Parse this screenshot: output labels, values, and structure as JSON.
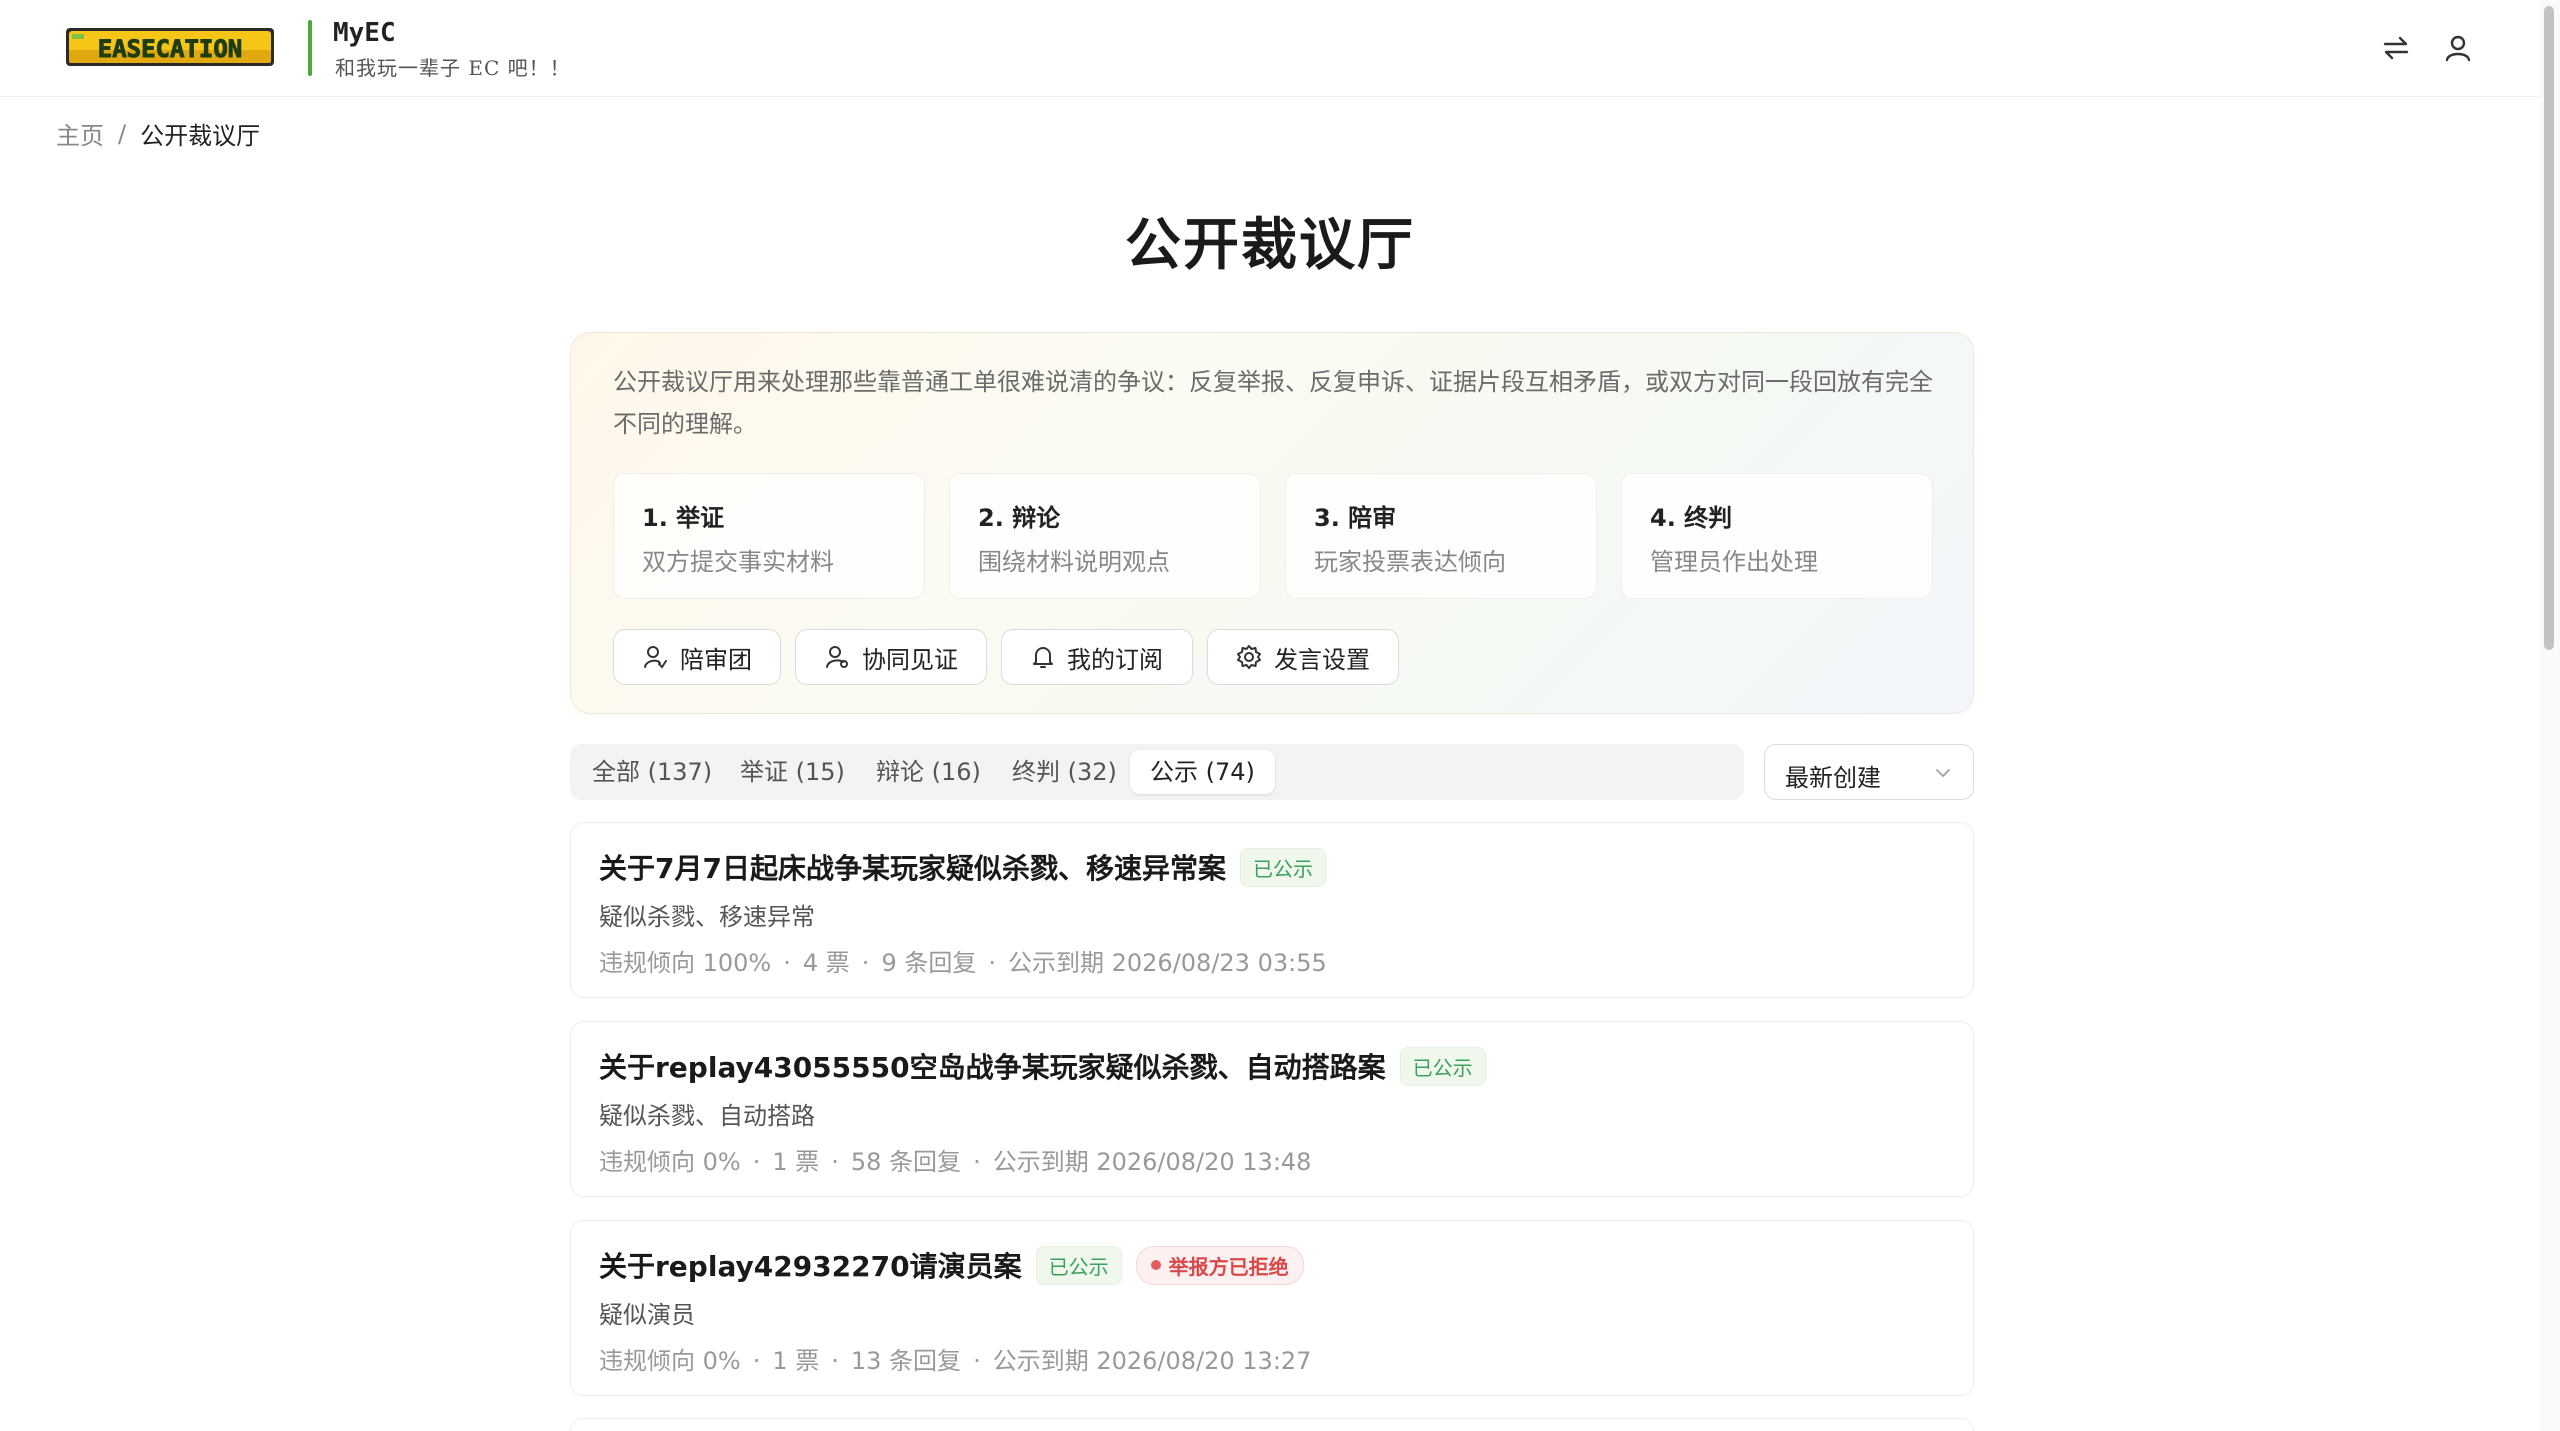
{
  "header": {
    "logo_text": "EASECATION",
    "brand_name": "MyEC",
    "slogan": "和我玩一辈子 EC 吧！！",
    "icons": [
      "switch-icon",
      "user-icon"
    ]
  },
  "breadcrumb": {
    "home": "主页",
    "separator": "/",
    "current": "公开裁议厅"
  },
  "page_title": "公开裁议厅",
  "intro": {
    "description": "公开裁议厅用来处理那些靠普通工单很难说清的争议：反复举报、反复申诉、证据片段互相矛盾，或双方对同一段回放有完全不同的理解。",
    "steps": [
      {
        "title": "1. 举证",
        "subtitle": "双方提交事实材料"
      },
      {
        "title": "2. 辩论",
        "subtitle": "围绕材料说明观点"
      },
      {
        "title": "3. 陪审",
        "subtitle": "玩家投票表达倾向"
      },
      {
        "title": "4. 终判",
        "subtitle": "管理员作出处理"
      }
    ],
    "actions": [
      {
        "label": "陪审团",
        "icon": "jury-icon"
      },
      {
        "label": "协同见证",
        "icon": "witness-icon"
      },
      {
        "label": "我的订阅",
        "icon": "bell-icon"
      },
      {
        "label": "发言设置",
        "icon": "gear-icon"
      }
    ]
  },
  "filters": {
    "tabs": [
      {
        "label": "全部 (137)"
      },
      {
        "label": "举证 (15)"
      },
      {
        "label": "辩论 (16)"
      },
      {
        "label": "终判 (32)"
      },
      {
        "label": "公示 (74)",
        "active": true
      }
    ],
    "sort": {
      "selected": "最新创建"
    }
  },
  "cases": [
    {
      "title": "关于7月7日起床战争某玩家疑似杀戮、移速异常案",
      "badge": "已公示",
      "subtitle": "疑似杀戮、移速异常",
      "tendency": "违规倾向 100%",
      "votes": "4 票",
      "replies": "9 条回复",
      "deadline": "公示到期 2026/08/23 03:55"
    },
    {
      "title": "关于replay43055550空岛战争某玩家疑似杀戮、自动搭路案",
      "badge": "已公示",
      "subtitle": "疑似杀戮、自动搭路",
      "tendency": "违规倾向 0%",
      "votes": "1 票",
      "replies": "58 条回复",
      "deadline": "公示到期 2026/08/20 13:48"
    },
    {
      "title": "关于replay42932270请演员案",
      "badge": "已公示",
      "extra_badge": "举报方已拒绝",
      "subtitle": "疑似演员",
      "tendency": "违规倾向 0%",
      "votes": "1 票",
      "replies": "13 条回复",
      "deadline": "公示到期 2026/08/20 13:27"
    }
  ],
  "meta_separator": "·",
  "colors": {
    "accent_green": "#4fa83a",
    "badge_green": "#3aa05a",
    "badge_red": "#d94848",
    "logo_yellow": "#f5c518"
  }
}
